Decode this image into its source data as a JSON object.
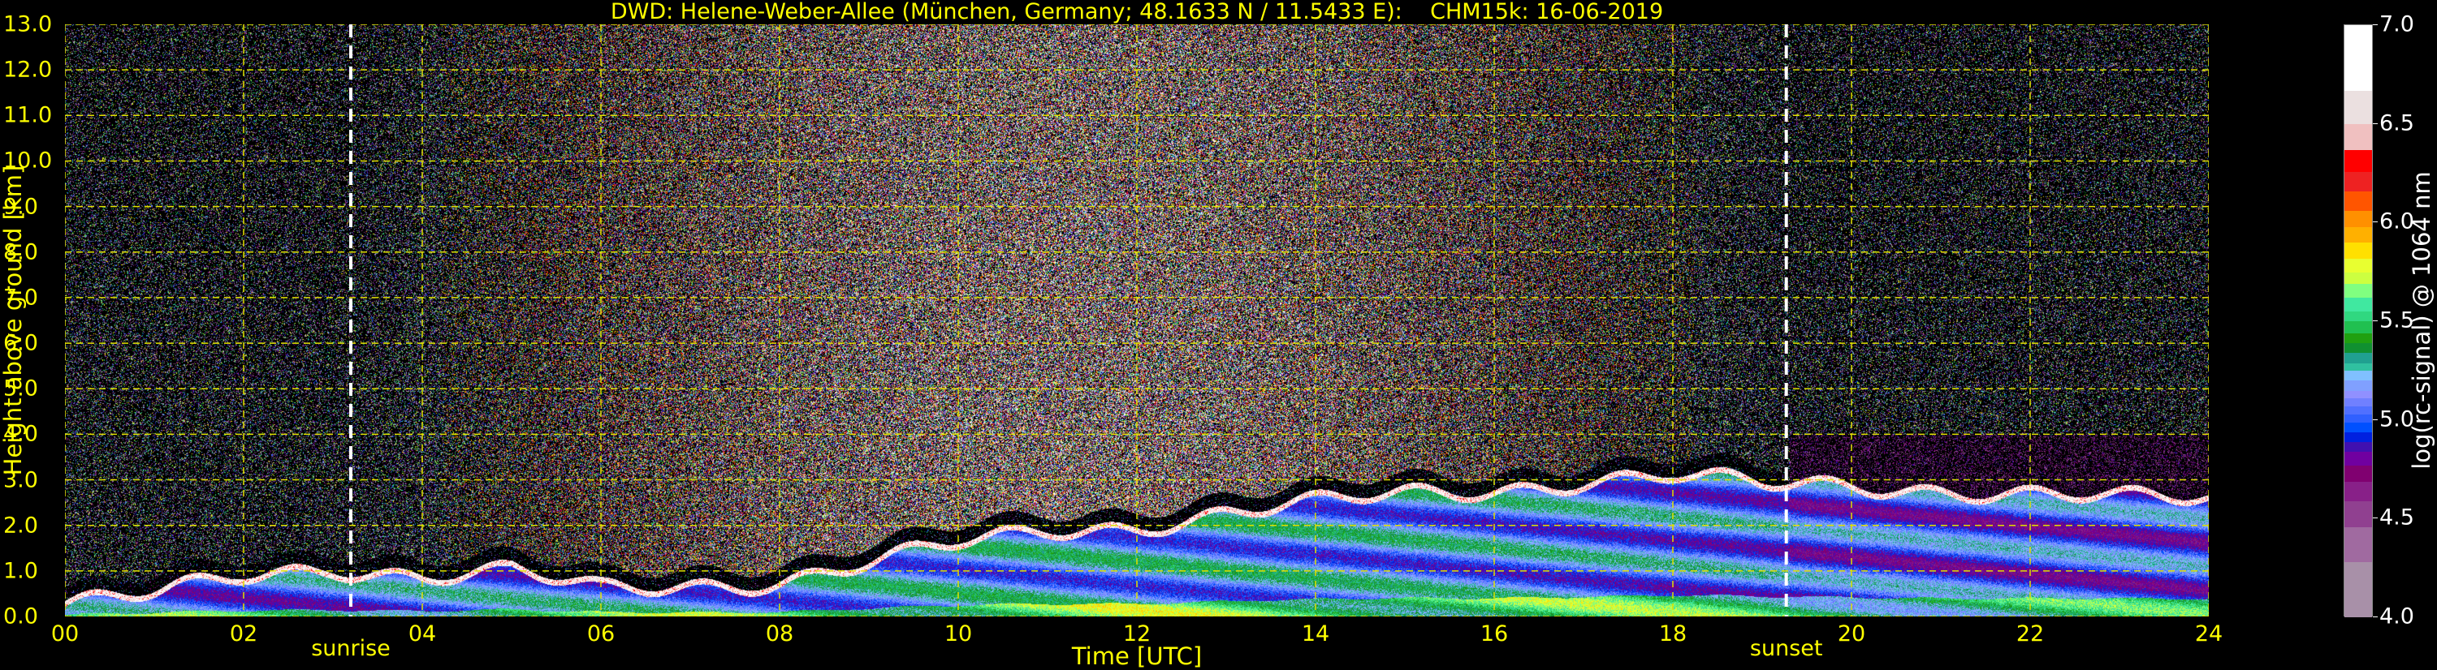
{
  "title": "DWD: Helene-Weber-Allee (München, Germany; 48.1633 N / 11.5433 E):    CHM15k: 16-06-2019",
  "chart_data": {
    "type": "heatmap",
    "title": "DWD: Helene-Weber-Allee (München, Germany; 48.1633 N / 11.5433 E):    CHM15k: 16-06-2019",
    "xlabel": "Time [UTC]",
    "ylabel": "Height above ground [km]",
    "xlim": [
      0,
      24
    ],
    "ylim": [
      0,
      13
    ],
    "grid": true,
    "xticks": [
      0,
      2,
      4,
      6,
      8,
      10,
      12,
      14,
      16,
      18,
      20,
      22,
      24
    ],
    "xtick_labels": [
      "00",
      "02",
      "04",
      "06",
      "08",
      "10",
      "12",
      "14",
      "16",
      "18",
      "20",
      "22",
      "24"
    ],
    "yticks": [
      0,
      1,
      2,
      3,
      4,
      5,
      6,
      7,
      8,
      9,
      10,
      11,
      12,
      13
    ],
    "ytick_labels": [
      "0.0",
      "1.0",
      "2.0",
      "3.0",
      "4.0",
      "5.0",
      "6.0",
      "7.0",
      "8.0",
      "9.0",
      "10.0",
      "11.0",
      "12.0",
      "13.0"
    ],
    "annotations": [
      {
        "label": "sunrise",
        "time_utc": 3.2
      },
      {
        "label": "sunset",
        "time_utc": 19.27
      }
    ],
    "colorbar": {
      "label": "log(rc-signal) @ 1064 nm",
      "range": [
        4.0,
        7.0
      ],
      "tick_values": [
        4.0,
        4.5,
        5.0,
        5.5,
        6.0,
        6.5,
        7.0
      ],
      "tick_labels": [
        "4.0",
        "4.5",
        "5.0",
        "5.5",
        "6.0",
        "6.5",
        "7.0"
      ],
      "bounds": [
        4.0,
        4.28,
        4.46,
        4.59,
        4.69,
        4.77,
        4.84,
        4.89,
        4.94,
        4.99,
        5.03,
        5.07,
        5.11,
        5.15,
        5.2,
        5.25,
        5.29,
        5.34,
        5.39,
        5.44,
        5.5,
        5.55,
        5.62,
        5.69,
        5.75,
        5.82,
        5.9,
        5.98,
        6.06,
        6.16,
        6.26,
        6.37,
        6.5,
        6.67,
        7.0
      ],
      "colors": [
        "#a890a8",
        "#a06aa0",
        "#904090",
        "#882088",
        "#800070",
        "#7000a0",
        "#4010b0",
        "#0020e0",
        "#0050ff",
        "#3060ff",
        "#5070ff",
        "#7080ff",
        "#9090ff",
        "#80a0ff",
        "#80c0ff",
        "#30c0a0",
        "#20a090",
        "#109030",
        "#20a010",
        "#20c050",
        "#30d880",
        "#40e8a0",
        "#80ff80",
        "#ccff40",
        "#e8ff30",
        "#ffe000",
        "#ffb000",
        "#ff9000",
        "#ff5500",
        "#ee2222",
        "#ff0000",
        "#f0c0c0",
        "#ebe0e0",
        "#ffffff"
      ]
    },
    "aerosol_layer_top_km": {
      "time_utc": [
        0,
        1,
        2,
        3,
        4,
        5,
        6,
        7,
        8,
        9,
        10,
        11,
        12,
        13,
        14,
        15,
        16,
        17,
        18,
        19,
        20,
        21,
        22,
        23,
        24
      ],
      "height_km": [
        0.3,
        0.5,
        0.9,
        1.1,
        0.9,
        1.0,
        0.6,
        0.7,
        0.8,
        1.2,
        1.6,
        1.9,
        2.0,
        2.3,
        2.5,
        2.7,
        2.8,
        3.0,
        3.1,
        2.9,
        2.9,
        2.8,
        2.7,
        2.6,
        2.6
      ]
    }
  }
}
